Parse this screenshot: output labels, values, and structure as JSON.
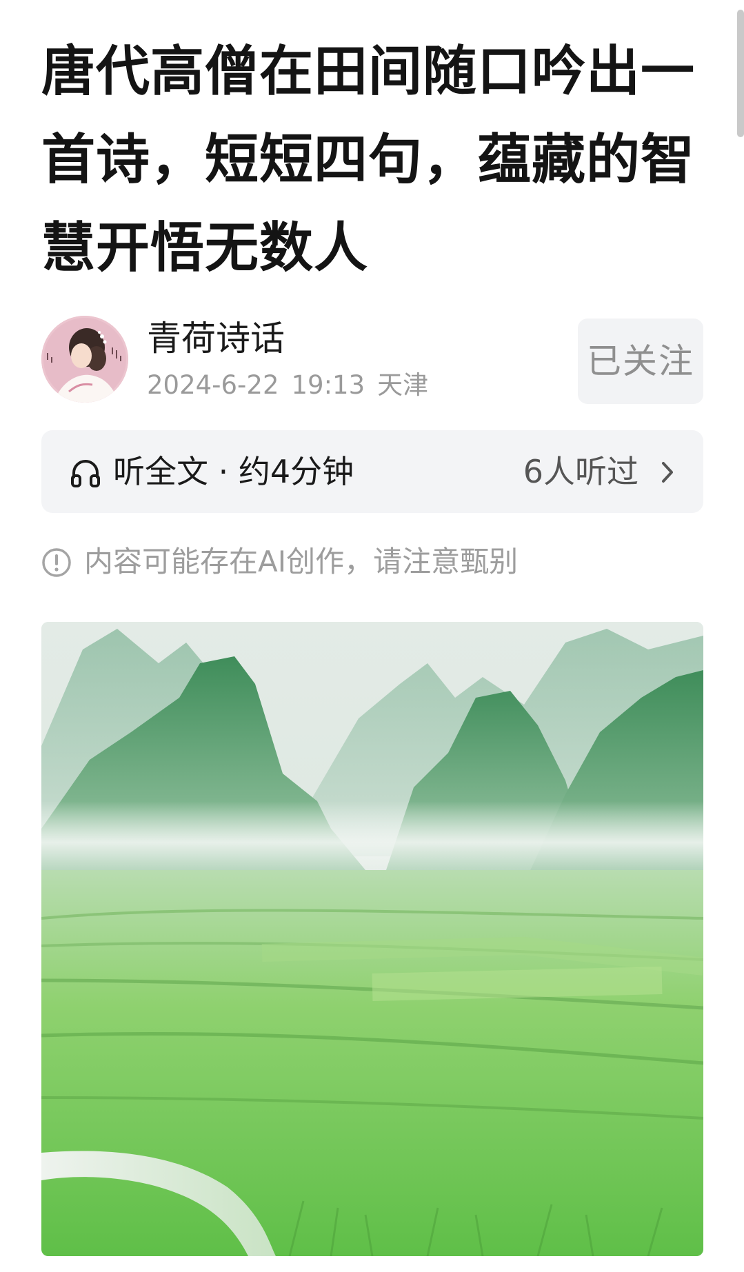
{
  "article": {
    "title": "唐代高僧在田间随口吟出一首诗，短短四句，蕴藏的智慧开悟无数人"
  },
  "author": {
    "name": "青荷诗话",
    "date": "2024-6-22",
    "time": "19:13",
    "location": "天津",
    "follow_label": "已关注"
  },
  "listen": {
    "label": "听全文 · 约4分钟",
    "count": "6人听过",
    "icon": "headphone-icon"
  },
  "notice": {
    "text": "内容可能存在AI创作，请注意甄别",
    "icon": "info-icon"
  },
  "colors": {
    "listen_bar_bg": "#f3f4f6",
    "follow_bg": "#f2f3f5",
    "meta_text": "#9a9a9a",
    "hero_green": "#6fcf54",
    "mountain_green": "#4f9a66"
  }
}
